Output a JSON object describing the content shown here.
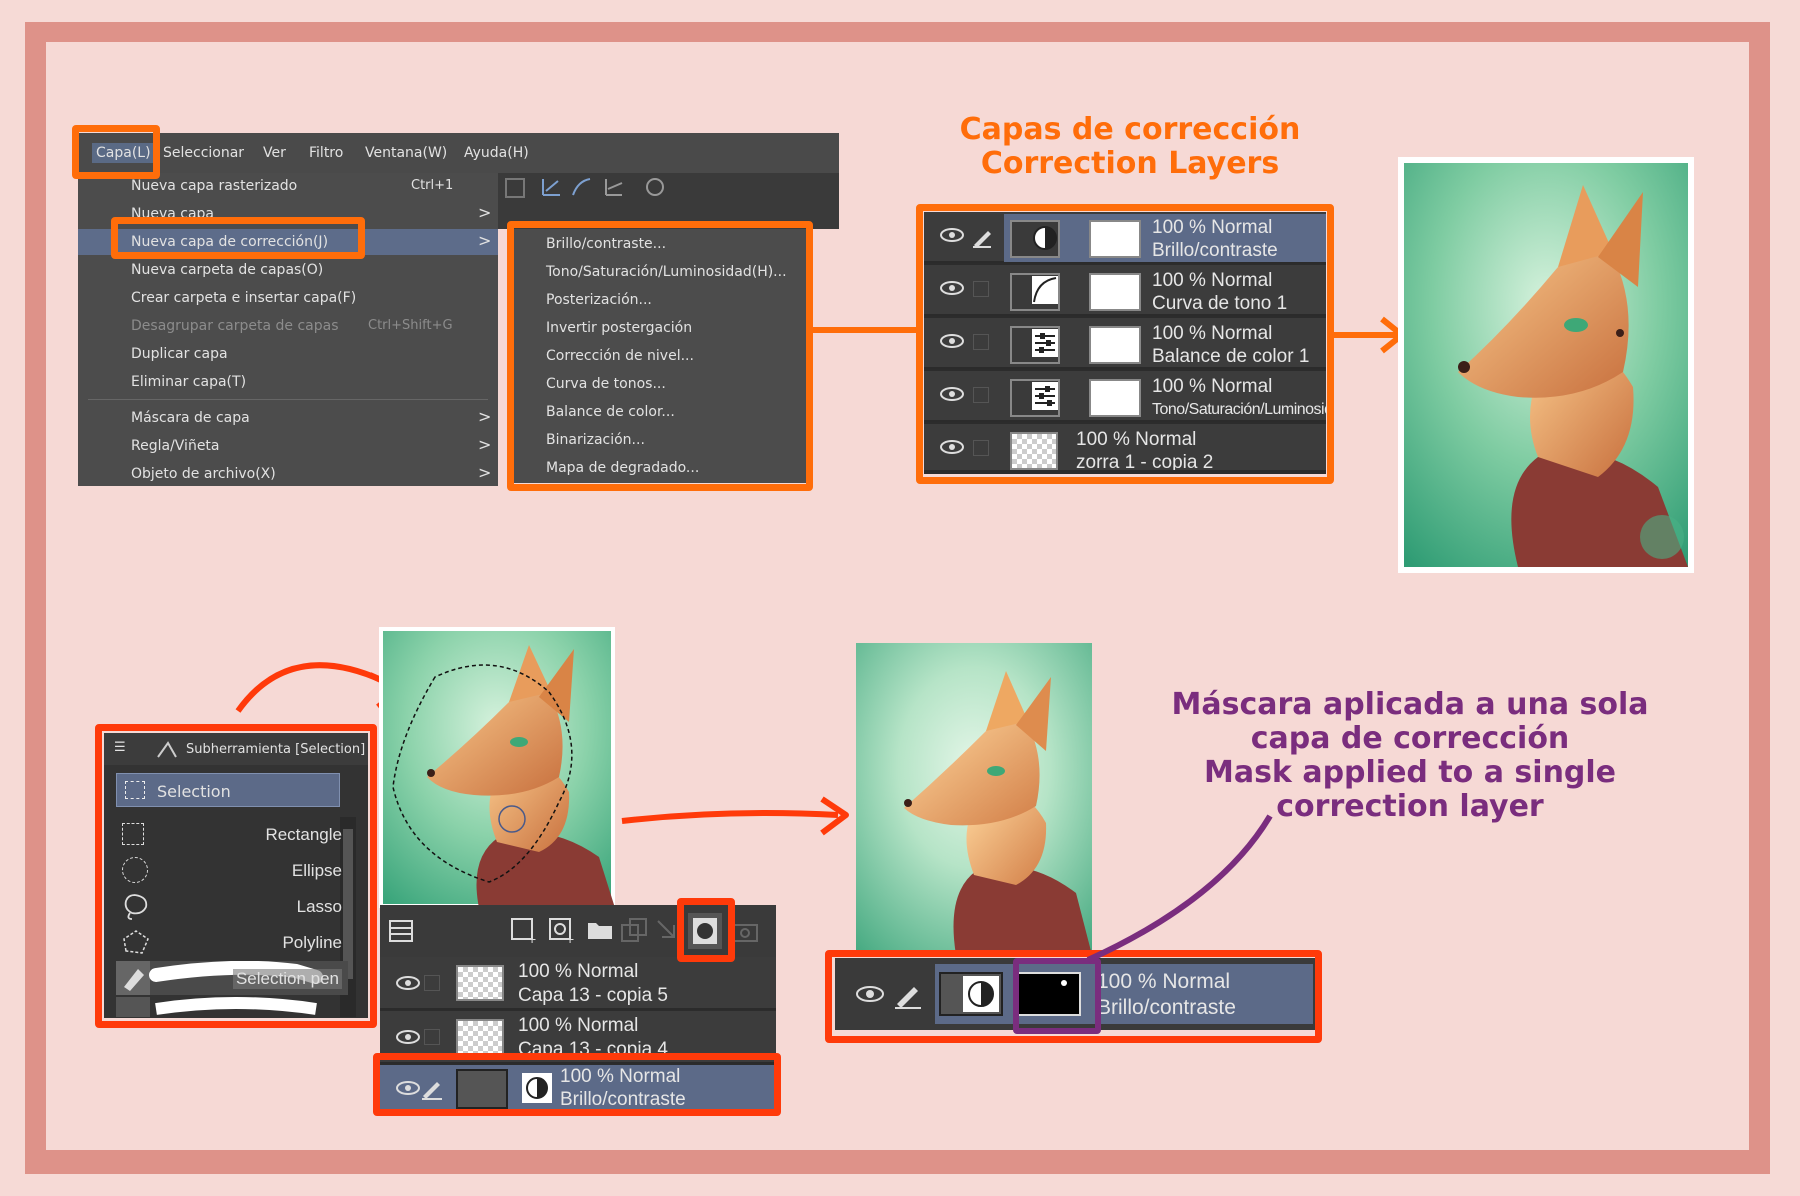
{
  "menubar": {
    "items": [
      "Capa(L)",
      "Seleccionar",
      "Ver",
      "Filtro",
      "Ventana(W)",
      "Ayuda(H)"
    ]
  },
  "layer_menu": {
    "items": [
      {
        "label": "Nueva capa rasterizado",
        "shortcut": "Ctrl+1"
      },
      {
        "label": "Nueva capa",
        "arrow": ">"
      },
      {
        "label": "Nueva capa de corrección(J)",
        "arrow": ">"
      },
      {
        "label": "Nueva carpeta de capas(O)"
      },
      {
        "label": "Crear carpeta e insertar capa(F)"
      },
      {
        "label": "Desagrupar carpeta de capas",
        "shortcut": "Ctrl+Shift+G"
      },
      {
        "label": "Duplicar capa"
      },
      {
        "label": "Eliminar capa(T)"
      },
      {
        "label": "Máscara de capa",
        "arrow": ">"
      },
      {
        "label": "Regla/Viñeta",
        "arrow": ">"
      },
      {
        "label": "Objeto de archivo(X)",
        "arrow": ">"
      }
    ]
  },
  "correction_submenu": {
    "items": [
      "Brillo/contraste...",
      "Tono/Saturación/Luminosidad(H)...",
      "Posterización...",
      "Invertir postergación",
      "Corrección de nivel...",
      "Curva de tonos...",
      "Balance de color...",
      "Binarización...",
      "Mapa de degradado..."
    ]
  },
  "title_correction": {
    "line1": "Capas de corrección",
    "line2": "Correction Layers"
  },
  "layers_top": [
    {
      "mode": "100 % Normal",
      "name": "Brillo/contraste"
    },
    {
      "mode": "100 % Normal",
      "name": "Curva de tono 1"
    },
    {
      "mode": "100 % Normal",
      "name": "Balance de color 1"
    },
    {
      "mode": "100 % Normal",
      "name": "Tono/Saturación/Luminosid"
    },
    {
      "mode": "100 % Normal",
      "name": "zorra 1 - copia 2"
    }
  ],
  "subtool": {
    "header": "Subherramienta [Selection]",
    "group": "Selection",
    "tools": [
      "Rectangle",
      "Ellipse",
      "Lasso",
      "Polyline",
      "Selection pen"
    ]
  },
  "layers_bottom": [
    {
      "mode": "100 % Normal",
      "name": "Capa 13 - copia 5"
    },
    {
      "mode": "100 % Normal",
      "name": "Capa 13 - copia 4"
    },
    {
      "mode": "100 % Normal",
      "name": "Brillo/contraste"
    }
  ],
  "mask_layer": {
    "mode": "100 % Normal",
    "name": "Brillo/contraste"
  },
  "mask_note": {
    "line1": "Máscara aplicada a una sola",
    "line2": "capa de corrección",
    "line3": "Mask applied to a  single",
    "line4": "correction layer"
  },
  "colors": {
    "orange": "#ff6d0a",
    "red": "#ff3a0a",
    "purple": "#7a2d7e",
    "frame": "#de9289",
    "bg": "#f6d9d5"
  }
}
